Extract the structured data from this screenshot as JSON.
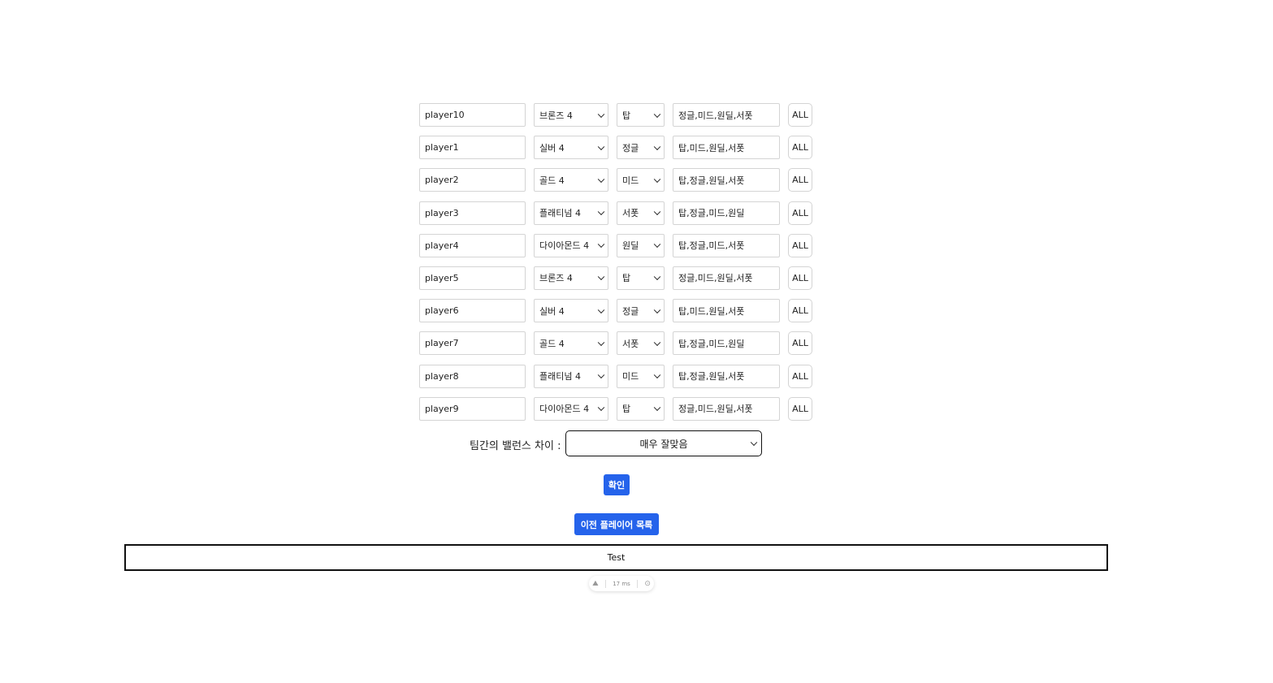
{
  "players": [
    {
      "name": "player10",
      "tier": "브론즈 4",
      "position": "탑",
      "sub_positions": "정글,미드,원딜,서폿",
      "all_label": "ALL"
    },
    {
      "name": "player1",
      "tier": "실버 4",
      "position": "정글",
      "sub_positions": "탑,미드,원딜,서폿",
      "all_label": "ALL"
    },
    {
      "name": "player2",
      "tier": "골드 4",
      "position": "미드",
      "sub_positions": "탑,정글,원딜,서폿",
      "all_label": "ALL"
    },
    {
      "name": "player3",
      "tier": "플래티넘 4",
      "position": "서폿",
      "sub_positions": "탑,정글,미드,원딜",
      "all_label": "ALL"
    },
    {
      "name": "player4",
      "tier": "다이아몬드 4",
      "position": "원딜",
      "sub_positions": "탑,정글,미드,서폿",
      "all_label": "ALL"
    },
    {
      "name": "player5",
      "tier": "브론즈 4",
      "position": "탑",
      "sub_positions": "정글,미드,원딜,서폿",
      "all_label": "ALL"
    },
    {
      "name": "player6",
      "tier": "실버 4",
      "position": "정글",
      "sub_positions": "탑,미드,원딜,서폿",
      "all_label": "ALL"
    },
    {
      "name": "player7",
      "tier": "골드 4",
      "position": "서폿",
      "sub_positions": "탑,정글,미드,원딜",
      "all_label": "ALL"
    },
    {
      "name": "player8",
      "tier": "플래티넘 4",
      "position": "미드",
      "sub_positions": "탑,정글,원딜,서폿",
      "all_label": "ALL"
    },
    {
      "name": "player9",
      "tier": "다이아몬드 4",
      "position": "탑",
      "sub_positions": "정글,미드,원딜,서폿",
      "all_label": "ALL"
    }
  ],
  "balance": {
    "label": "팀간의 밸런스 차이 :",
    "selected": "매우 잘맞음"
  },
  "confirm_label": "확인",
  "prev_players_label": "이전 플레이어 목록",
  "result_text": "Test",
  "devbar": {
    "logo_icon": "nuxt-mountain-icon",
    "time_text": "17",
    "time_unit": "ms",
    "inspect_icon": "target-icon"
  },
  "colors": {
    "primary_button": "#2563eb",
    "border": "#d4d4d4"
  }
}
